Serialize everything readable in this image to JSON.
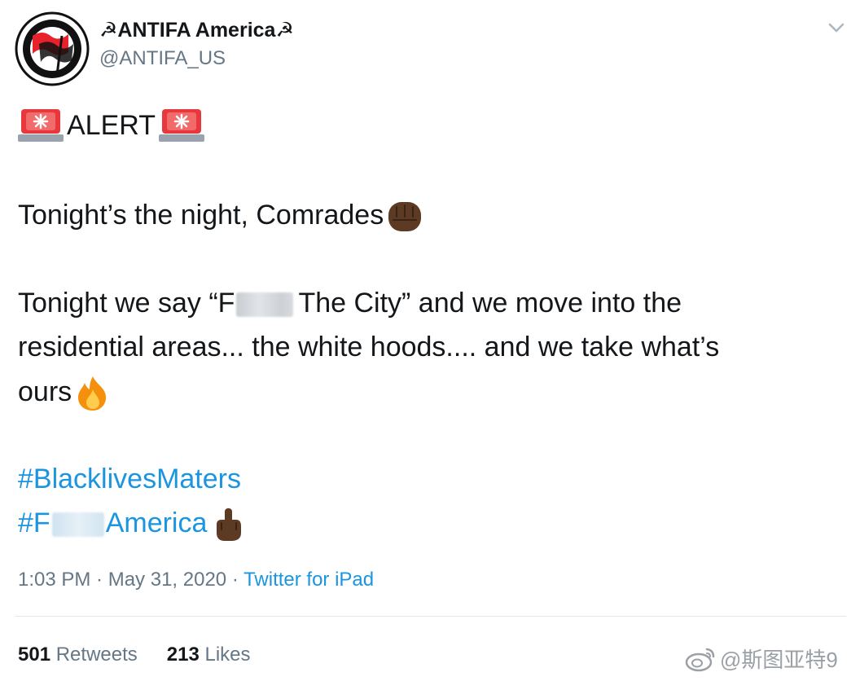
{
  "account": {
    "display_name": "☭ANTIFA America☭",
    "handle": "@ANTIFA_US",
    "avatar_icon": "antifa-flag-logo-icon"
  },
  "tweet": {
    "alert": "ALERT",
    "line1": "Tonight’s the night, Comrades",
    "line2_a": "Tonight we say “F",
    "line2_b": "The City” and we move into the",
    "line3": "residential areas... the white hoods.... and we take what’s",
    "line4": "ours",
    "hashtag1": "#BlacklivesMaters",
    "hashtag2_a": "#F",
    "hashtag2_b": "America"
  },
  "meta": {
    "time": "1:03 PM",
    "date": "May 31, 2020",
    "source": "Twitter for iPad"
  },
  "stats": {
    "retweets_count": "501",
    "retweets_label": "Retweets",
    "likes_count": "213",
    "likes_label": "Likes"
  },
  "watermark": {
    "text": "@斯图亚特9",
    "icon": "weibo-logo-icon"
  },
  "colors": {
    "link": "#1b95e0",
    "secondary_text": "#657786",
    "primary_text": "#14171a",
    "avatar_red": "#e8222b"
  }
}
